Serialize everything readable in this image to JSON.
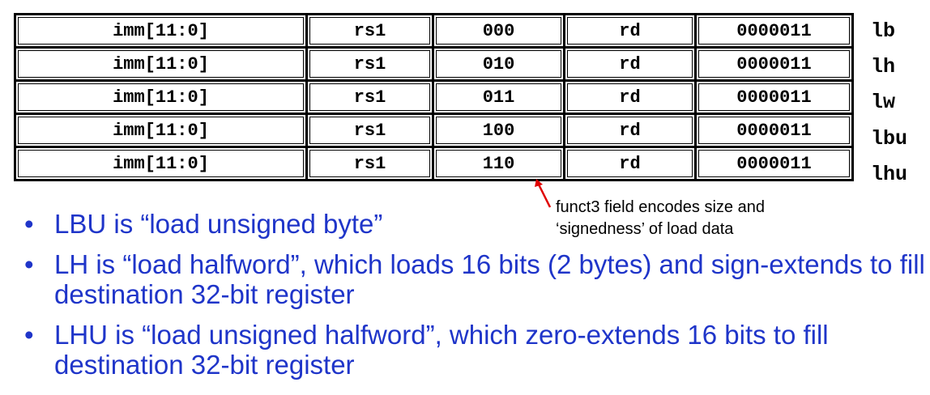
{
  "rows": [
    {
      "imm": "imm[11:0]",
      "rs1": "rs1",
      "funct3": "000",
      "rd": "rd",
      "opcode": "0000011",
      "mnemonic": "lb"
    },
    {
      "imm": "imm[11:0]",
      "rs1": "rs1",
      "funct3": "010",
      "rd": "rd",
      "opcode": "0000011",
      "mnemonic": "lh"
    },
    {
      "imm": "imm[11:0]",
      "rs1": "rs1",
      "funct3": "011",
      "rd": "rd",
      "opcode": "0000011",
      "mnemonic": "lw"
    },
    {
      "imm": "imm[11:0]",
      "rs1": "rs1",
      "funct3": "100",
      "rd": "rd",
      "opcode": "0000011",
      "mnemonic": "lbu"
    },
    {
      "imm": "imm[11:0]",
      "rs1": "rs1",
      "funct3": "110",
      "rd": "rd",
      "opcode": "0000011",
      "mnemonic": "lhu"
    }
  ],
  "annotation": {
    "line1": "funct3 field encodes size and",
    "line2": "‘signedness’ of load data",
    "arrow_color": "#e00000"
  },
  "bullets": [
    "LBU is “load unsigned byte”",
    "LH is “load halfword”, which loads 16 bits (2 bytes) and sign-extends to fill destination 32-bit register",
    "LHU is “load unsigned halfword”, which zero-extends 16 bits to fill destination 32-bit register"
  ],
  "colors": {
    "bullet_text": "#1f35c9"
  }
}
